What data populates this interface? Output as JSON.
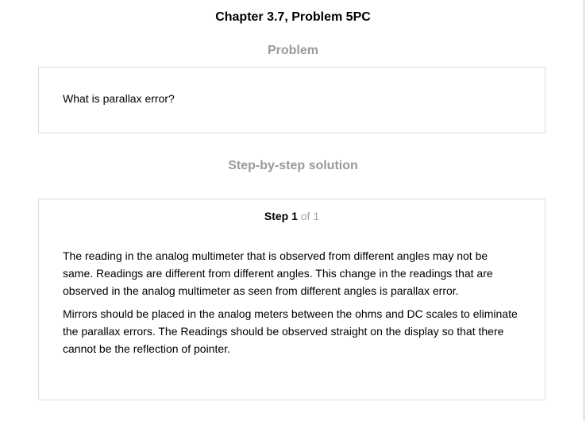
{
  "header": {
    "chapter_title": "Chapter 3.7, Problem 5PC"
  },
  "problem": {
    "heading": "Problem",
    "text": "What is parallax error?"
  },
  "solution": {
    "heading": "Step-by-step solution",
    "step_label": "Step 1",
    "step_of": "of 1",
    "paragraphs": [
      "The reading in the analog multimeter that is observed from different angles may not be same. Readings are different from different angles. This change in the readings that are observed in the analog multimeter as seen from different angles is parallax error.",
      "Mirrors should be placed in the analog meters between the ohms and DC scales to eliminate the parallax errors. The Readings should be observed straight on the display so that there cannot be the reflection of pointer."
    ]
  }
}
